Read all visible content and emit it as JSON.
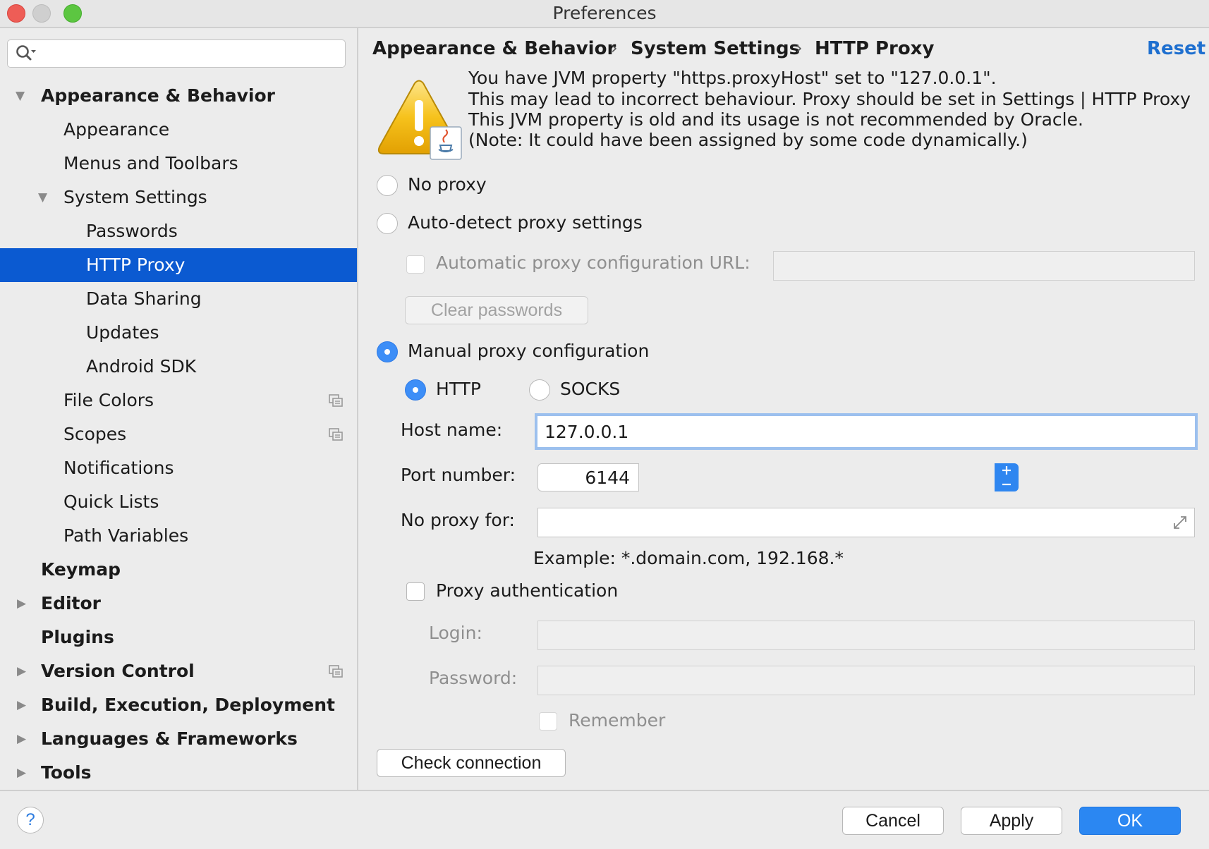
{
  "window": {
    "title": "Preferences",
    "colors": {
      "close": "#ee5d56",
      "minimize": "#cfcfcf",
      "zoom": "#5cc641"
    }
  },
  "sidebar": {
    "search": {
      "value": "",
      "placeholder": ""
    },
    "items": [
      {
        "label": "Appearance & Behavior",
        "expanded": true
      },
      {
        "label": "Appearance"
      },
      {
        "label": "Menus and Toolbars"
      },
      {
        "label": "System Settings",
        "expanded": true
      },
      {
        "label": "Passwords"
      },
      {
        "label": "HTTP Proxy",
        "selected": true
      },
      {
        "label": "Data Sharing"
      },
      {
        "label": "Updates"
      },
      {
        "label": "Android SDK"
      },
      {
        "label": "File Colors"
      },
      {
        "label": "Scopes"
      },
      {
        "label": "Notifications"
      },
      {
        "label": "Quick Lists"
      },
      {
        "label": "Path Variables"
      },
      {
        "label": "Keymap"
      },
      {
        "label": "Editor",
        "expanded": false
      },
      {
        "label": "Plugins"
      },
      {
        "label": "Version Control",
        "expanded": false
      },
      {
        "label": "Build, Execution, Deployment",
        "expanded": false
      },
      {
        "label": "Languages & Frameworks",
        "expanded": false
      },
      {
        "label": "Tools",
        "expanded": false
      }
    ],
    "selected_color": "#0b5ad1"
  },
  "breadcrumb": {
    "items": [
      "Appearance & Behavior",
      "System Settings",
      "HTTP Proxy"
    ],
    "separator": "›",
    "reset_label": "Reset"
  },
  "warning": {
    "lines": [
      "You have JVM property \"https.proxyHost\" set to \"127.0.0.1\".",
      "This may lead to incorrect behaviour. Proxy should be set in Settings | HTTP Proxy",
      "This JVM property is old and its usage is not recommended by Oracle.",
      "(Note: It could have been assigned by some code dynamically.)"
    ]
  },
  "proxy": {
    "no_proxy_label": "No proxy",
    "auto_detect_label": "Auto-detect proxy settings",
    "auto_config_url_label": "Automatic proxy configuration URL:",
    "auto_config_url_value": "",
    "clear_passwords_label": "Clear passwords",
    "manual_label": "Manual proxy configuration",
    "selected_mode": "manual",
    "type_http_label": "HTTP",
    "type_socks_label": "SOCKS",
    "selected_type": "HTTP",
    "host_label": "Host name:",
    "host_value": "127.0.0.1",
    "port_label": "Port number:",
    "port_value": "6144",
    "no_proxy_for_label": "No proxy for:",
    "no_proxy_for_value": "",
    "example_text": "Example: *.domain.com, 192.168.*",
    "auth_label": "Proxy authentication",
    "login_label": "Login:",
    "login_value": "",
    "password_label": "Password:",
    "password_value": "",
    "remember_label": "Remember",
    "check_connection_label": "Check connection"
  },
  "footer": {
    "help_label": "?",
    "cancel_label": "Cancel",
    "apply_label": "Apply",
    "ok_label": "OK"
  },
  "colors": {
    "accent": "#2b87f2",
    "link": "#1e6fcf"
  }
}
